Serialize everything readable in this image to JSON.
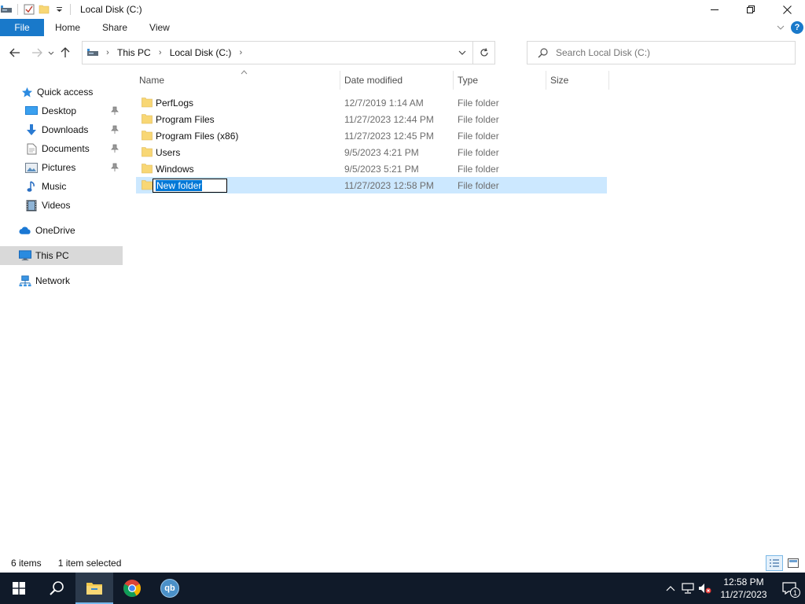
{
  "window": {
    "title": "Local Disk (C:)"
  },
  "ribbon": {
    "file_label": "File",
    "tabs": [
      "Home",
      "Share",
      "View"
    ],
    "help_label": "?"
  },
  "address": {
    "segments": [
      "This PC",
      "Local Disk (C:)"
    ],
    "search_placeholder": "Search Local Disk (C:)"
  },
  "nav": {
    "items": [
      {
        "label": "Quick access",
        "icon": "star-icon"
      },
      {
        "label": "Desktop",
        "icon": "desktop-icon",
        "pinned": true
      },
      {
        "label": "Downloads",
        "icon": "download-icon",
        "pinned": true
      },
      {
        "label": "Documents",
        "icon": "documents-icon",
        "pinned": true
      },
      {
        "label": "Pictures",
        "icon": "pictures-icon",
        "pinned": true
      },
      {
        "label": "Music",
        "icon": "music-icon"
      },
      {
        "label": "Videos",
        "icon": "videos-icon"
      },
      {
        "label": "OneDrive",
        "icon": "cloud-icon"
      },
      {
        "label": "This PC",
        "icon": "computer-icon",
        "selected": true
      },
      {
        "label": "Network",
        "icon": "network-icon"
      }
    ]
  },
  "columns": {
    "name": "Name",
    "date": "Date modified",
    "type": "Type",
    "size": "Size"
  },
  "files": [
    {
      "name": "PerfLogs",
      "date": "12/7/2019 1:14 AM",
      "type": "File folder"
    },
    {
      "name": "Program Files",
      "date": "11/27/2023 12:44 PM",
      "type": "File folder"
    },
    {
      "name": "Program Files (x86)",
      "date": "11/27/2023 12:45 PM",
      "type": "File folder"
    },
    {
      "name": "Users",
      "date": "9/5/2023 4:21 PM",
      "type": "File folder"
    },
    {
      "name": "Windows",
      "date": "9/5/2023 5:21 PM",
      "type": "File folder"
    },
    {
      "name": "New folder",
      "date": "11/27/2023 12:58 PM",
      "type": "File folder",
      "renaming": true
    }
  ],
  "status": {
    "item_count": "6 items",
    "selection": "1 item selected"
  },
  "taskbar": {
    "time": "12:58 PM",
    "date": "11/27/2023",
    "notification_count": "1",
    "qb_label": "qb"
  },
  "colors": {
    "accent": "#1979ca",
    "selection": "#cce8ff",
    "taskbar": "#101a29",
    "folder": "#f8d775"
  }
}
